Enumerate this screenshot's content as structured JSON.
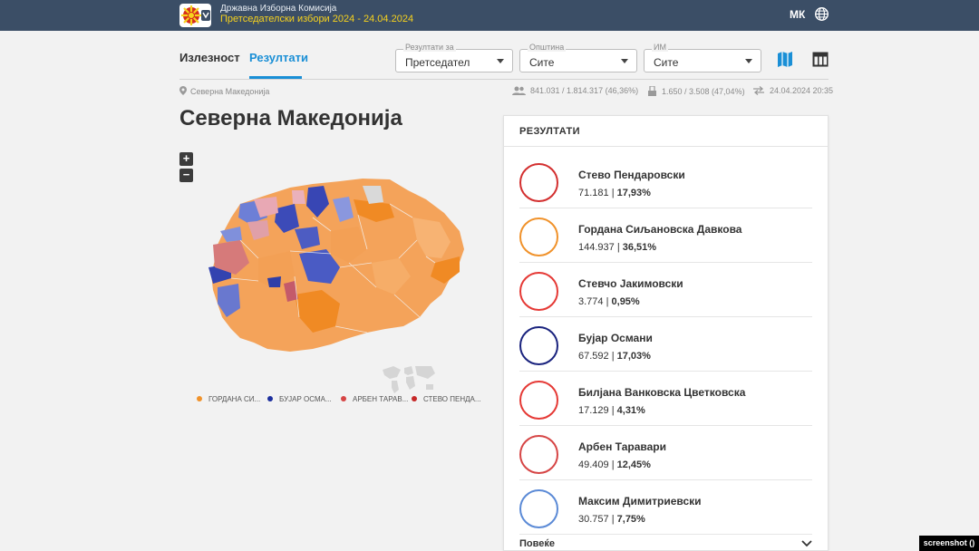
{
  "header": {
    "org_name": "Државна Изборна Комисија",
    "election_name": "Претседателски избори 2024 - 24.04.2024",
    "language": "МК"
  },
  "tabs": [
    {
      "label": "Излезност",
      "active": false
    },
    {
      "label": "Резултати",
      "active": true
    }
  ],
  "filters": {
    "results_for": {
      "label": "Резултати за",
      "value": "Претседател"
    },
    "municipality": {
      "label": "Општина",
      "value": "Сите"
    },
    "im": {
      "label": "ИМ",
      "value": "Сите"
    }
  },
  "breadcrumb": "Северна Македонија",
  "stats": {
    "voters": "841.031 / 1.814.317 (46,36%)",
    "polling_stations": "1.650 / 3.508 (47,04%)",
    "updated": "24.04.2024 20:35"
  },
  "region_title": "Северна Македонија",
  "map": {
    "zoom_in": "+",
    "zoom_out": "−",
    "legend": [
      {
        "label": "ГОРДАНА СИ...",
        "color": "#f0922b"
      },
      {
        "label": "БУЈАР ОСМА...",
        "color": "#1d2f9e"
      },
      {
        "label": "АРБЕН ТАРАВ...",
        "color": "#d64545"
      },
      {
        "label": "СТЕВО ПЕНДА...",
        "color": "#c62828"
      }
    ]
  },
  "results_panel": {
    "title": "РЕЗУЛТАТИ",
    "candidates": [
      {
        "name": "Стево Пендаровски",
        "votes": "71.181",
        "percent": "17,93%",
        "color": "#d32f2f"
      },
      {
        "name": "Гордана Сиљановска Давкова",
        "votes": "144.937",
        "percent": "36,51%",
        "color": "#f0922b"
      },
      {
        "name": "Стевчо Јакимовски",
        "votes": "3.774",
        "percent": "0,95%",
        "color": "#e53935"
      },
      {
        "name": "Бујар Османи",
        "votes": "67.592",
        "percent": "17,03%",
        "color": "#1a237e"
      },
      {
        "name": "Билјана Ванковска Цветковска",
        "votes": "17.129",
        "percent": "4,31%",
        "color": "#e53935"
      },
      {
        "name": "Арбен Таравари",
        "votes": "49.409",
        "percent": "12,45%",
        "color": "#d64545"
      },
      {
        "name": "Максим Димитриевски",
        "votes": "30.757",
        "percent": "7,75%",
        "color": "#5b8ad6"
      }
    ],
    "more_label": "Повеќе"
  },
  "badge": "screenshot ()",
  "icons": [
    "logo-icon",
    "globe-icon",
    "map-view-icon",
    "table-view-icon",
    "location-pin-icon",
    "voters-icon",
    "ballot-box-icon",
    "refresh-icon",
    "chevron-down-icon"
  ]
}
